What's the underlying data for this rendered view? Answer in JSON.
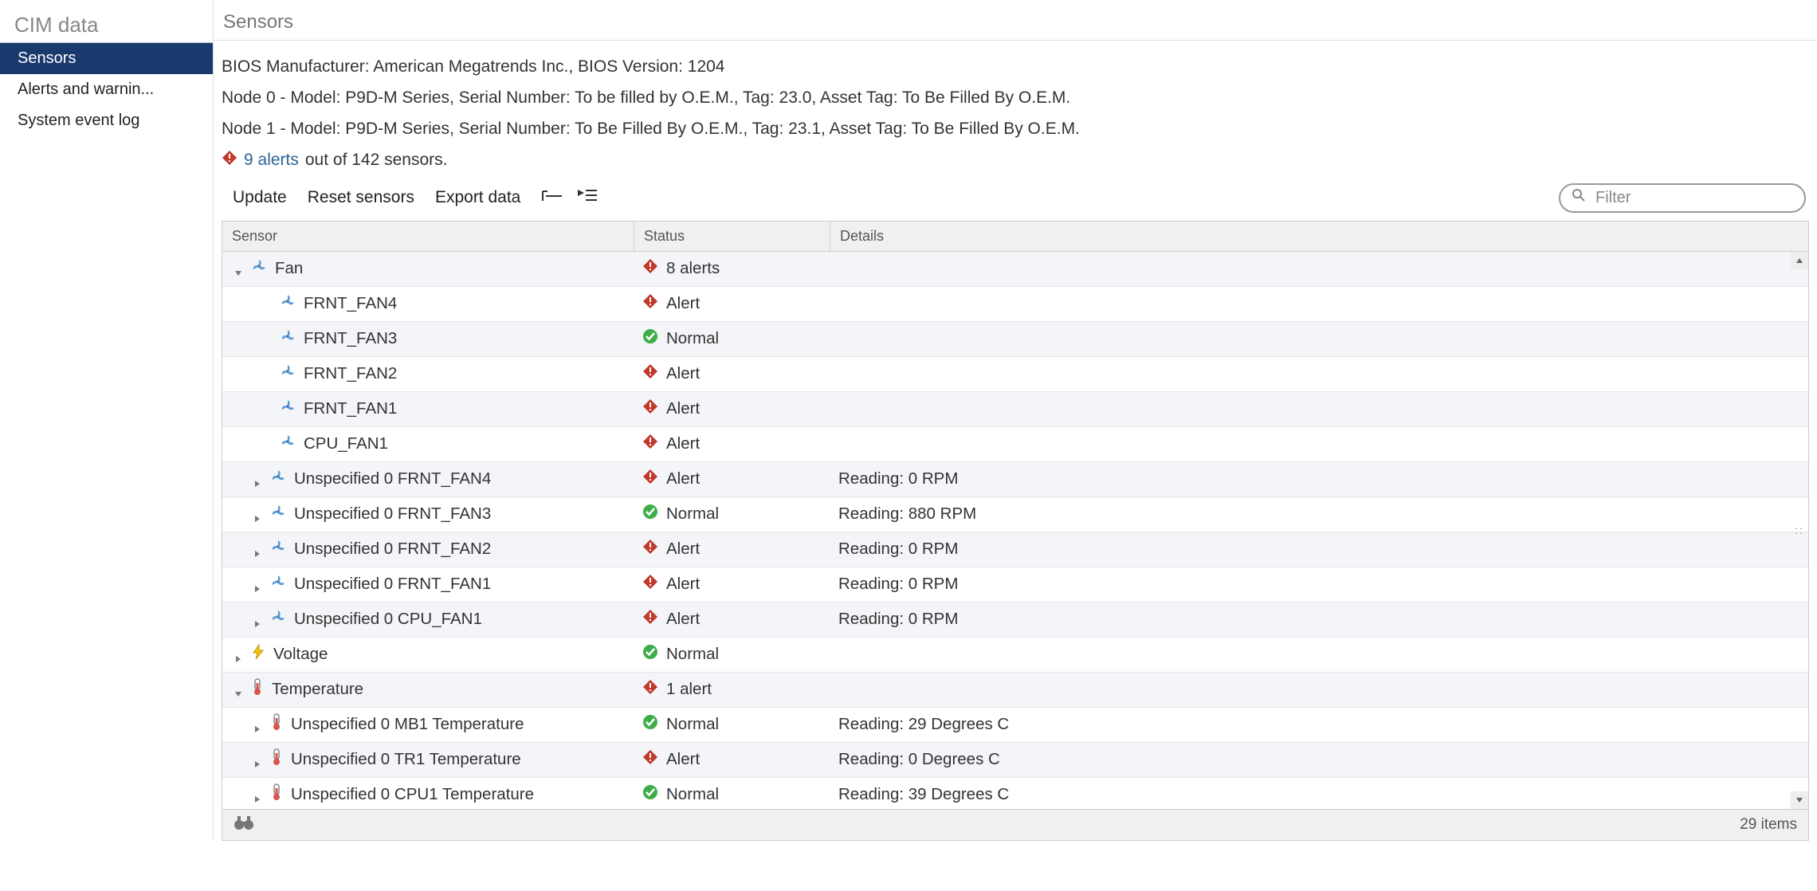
{
  "sidebar": {
    "title": "CIM data",
    "items": [
      {
        "label": "Sensors",
        "active": true
      },
      {
        "label": "Alerts and warnin...",
        "active": false
      },
      {
        "label": "System event log",
        "active": false
      }
    ]
  },
  "page": {
    "title": "Sensors",
    "bios_line": "BIOS Manufacturer: American Megatrends Inc.,   BIOS Version: 1204",
    "node0_line": "Node 0 -   Model: P9D-M Series,   Serial Number: To be filled by O.E.M.,   Tag: 23.0,   Asset Tag: To Be Filled By O.E.M.",
    "node1_line": "Node 1 -   Model: P9D-M Series,   Serial Number: To Be Filled By O.E.M.,   Tag: 23.1,   Asset Tag: To Be Filled By O.E.M.",
    "alerts_link": "9 alerts",
    "alerts_suffix": " out of 142 sensors."
  },
  "toolbar": {
    "update": "Update",
    "reset": "Reset sensors",
    "export": "Export data",
    "filter_placeholder": "Filter"
  },
  "table": {
    "headers": {
      "sensor": "Sensor",
      "status": "Status",
      "details": "Details"
    },
    "rows": [
      {
        "indent": 0,
        "exp": "down",
        "icon": "fan",
        "name": "Fan",
        "status": "alert",
        "status_text": "8 alerts",
        "details": ""
      },
      {
        "indent": 1,
        "exp": "none",
        "icon": "fan",
        "name": "FRNT_FAN4",
        "status": "alert",
        "status_text": "Alert",
        "details": ""
      },
      {
        "indent": 1,
        "exp": "none",
        "icon": "fan",
        "name": "FRNT_FAN3",
        "status": "normal",
        "status_text": "Normal",
        "details": ""
      },
      {
        "indent": 1,
        "exp": "none",
        "icon": "fan",
        "name": "FRNT_FAN2",
        "status": "alert",
        "status_text": "Alert",
        "details": ""
      },
      {
        "indent": 1,
        "exp": "none",
        "icon": "fan",
        "name": "FRNT_FAN1",
        "status": "alert",
        "status_text": "Alert",
        "details": ""
      },
      {
        "indent": 1,
        "exp": "none",
        "icon": "fan",
        "name": "CPU_FAN1",
        "status": "alert",
        "status_text": "Alert",
        "details": ""
      },
      {
        "indent": 1,
        "exp": "right",
        "icon": "fan",
        "name": "Unspecified 0 FRNT_FAN4",
        "status": "alert",
        "status_text": "Alert",
        "details": "Reading: 0 RPM"
      },
      {
        "indent": 1,
        "exp": "right",
        "icon": "fan",
        "name": "Unspecified 0 FRNT_FAN3",
        "status": "normal",
        "status_text": "Normal",
        "details": "Reading: 880 RPM"
      },
      {
        "indent": 1,
        "exp": "right",
        "icon": "fan",
        "name": "Unspecified 0 FRNT_FAN2",
        "status": "alert",
        "status_text": "Alert",
        "details": "Reading: 0 RPM"
      },
      {
        "indent": 1,
        "exp": "right",
        "icon": "fan",
        "name": "Unspecified 0 FRNT_FAN1",
        "status": "alert",
        "status_text": "Alert",
        "details": "Reading: 0 RPM"
      },
      {
        "indent": 1,
        "exp": "right",
        "icon": "fan",
        "name": "Unspecified 0 CPU_FAN1",
        "status": "alert",
        "status_text": "Alert",
        "details": "Reading: 0 RPM"
      },
      {
        "indent": 0,
        "exp": "right",
        "icon": "volt",
        "name": "Voltage",
        "status": "normal",
        "status_text": "Normal",
        "details": ""
      },
      {
        "indent": 0,
        "exp": "down",
        "icon": "temp",
        "name": "Temperature",
        "status": "alert",
        "status_text": "1 alert",
        "details": ""
      },
      {
        "indent": 1,
        "exp": "right",
        "icon": "temp",
        "name": "Unspecified 0 MB1 Temperature",
        "status": "normal",
        "status_text": "Normal",
        "details": "Reading: 29 Degrees C"
      },
      {
        "indent": 1,
        "exp": "right",
        "icon": "temp",
        "name": "Unspecified 0 TR1 Temperature",
        "status": "alert",
        "status_text": "Alert",
        "details": "Reading: 0 Degrees C"
      },
      {
        "indent": 1,
        "exp": "right",
        "icon": "temp",
        "name": "Unspecified 0 CPU1 Temperature",
        "status": "normal",
        "status_text": "Normal",
        "details": "Reading: 39 Degrees C"
      }
    ],
    "footer": "29 items"
  }
}
